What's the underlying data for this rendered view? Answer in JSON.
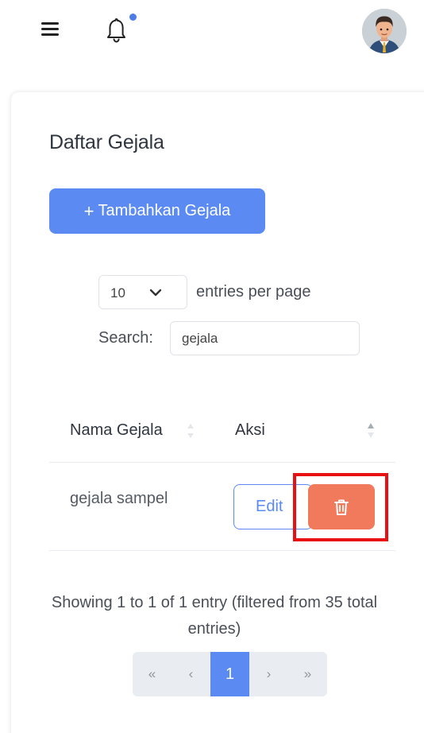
{
  "topbar": {
    "menu_icon": "hamburger-menu-icon",
    "notification_icon": "bell-icon",
    "has_unread_notification": true,
    "avatar": "user-avatar"
  },
  "page": {
    "title": "Daftar Gejala",
    "add_button_icon": "+",
    "add_button_label": "Tambahkan Gejala"
  },
  "table_controls": {
    "per_page_value": "10",
    "per_page_label": "entries per page",
    "search_label": "Search:",
    "search_value": "gejala"
  },
  "table": {
    "columns": [
      "Nama Gejala",
      "Aksi"
    ],
    "rows": [
      {
        "nama_gejala": "gejala sampel",
        "edit_label": "Edit",
        "delete_icon": "trash-icon"
      }
    ]
  },
  "footer": {
    "info": "Showing 1 to 1 of 1 entry (filtered from 35 total entries)",
    "pagination": {
      "first": "«",
      "prev": "‹",
      "current": "1",
      "next": "›",
      "last": "»"
    }
  },
  "colors": {
    "primary": "#5b8af2",
    "danger": "#f27a5c",
    "highlight": "#e81010",
    "notification_dot": "#4c7ce8"
  }
}
